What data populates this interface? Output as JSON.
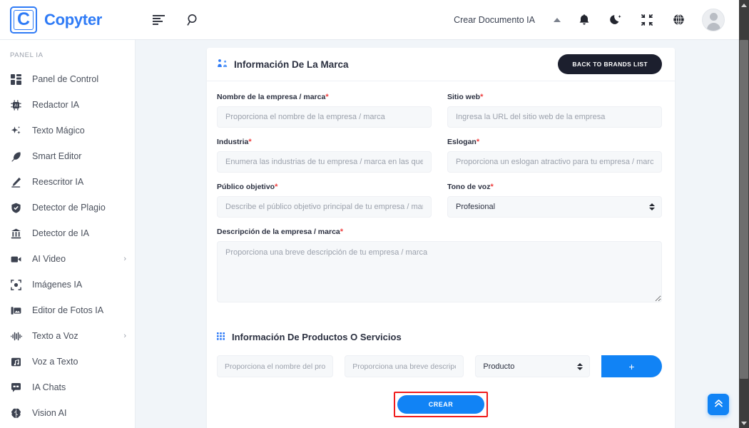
{
  "brand": {
    "logo_letter": "C",
    "name": "Copyter",
    "accent_color": "#2f7bf6"
  },
  "topbar": {
    "menu_icon": "list-menu-icon",
    "search_icon": "search-icon",
    "create_document_label": "Crear Documento IA",
    "caret_icon": "chevron-up-icon",
    "bell_icon": "bell-icon",
    "moon_icon": "moon-icon",
    "fullscreen_icon": "compress-icon",
    "globe_icon": "globe-icon",
    "avatar_icon": "user-avatar"
  },
  "sidebar": {
    "heading": "PANEL IA",
    "items": [
      {
        "label": "Panel de Control",
        "icon": "dashboard-grid-icon",
        "chevron": ""
      },
      {
        "label": "Redactor IA",
        "icon": "ai-chip-icon",
        "chevron": ""
      },
      {
        "label": "Texto Mágico",
        "icon": "sparkles-icon",
        "chevron": ""
      },
      {
        "label": "Smart Editor",
        "icon": "feather-pen-icon",
        "chevron": ""
      },
      {
        "label": "Reescritor IA",
        "icon": "pencil-icon",
        "chevron": ""
      },
      {
        "label": "Detector de Plagio",
        "icon": "shield-check-icon",
        "chevron": ""
      },
      {
        "label": "Detector de IA",
        "icon": "bank-detector-icon",
        "chevron": ""
      },
      {
        "label": "AI Video",
        "icon": "video-camera-icon",
        "chevron": "›"
      },
      {
        "label": "Imágenes IA",
        "icon": "image-frame-icon",
        "chevron": ""
      },
      {
        "label": "Editor de Fotos IA",
        "icon": "photo-editor-icon",
        "chevron": ""
      },
      {
        "label": "Texto a Voz",
        "icon": "audio-waveform-icon",
        "chevron": "›"
      },
      {
        "label": "Voz a Texto",
        "icon": "music-note-icon",
        "chevron": ""
      },
      {
        "label": "IA Chats",
        "icon": "chat-bubble-icon",
        "chevron": ""
      },
      {
        "label": "Vision AI",
        "icon": "brain-icon",
        "chevron": ""
      }
    ]
  },
  "card": {
    "title": "Información De La Marca",
    "title_icon": "brand-people-icon",
    "back_button": "BACK TO BRANDS LIST",
    "fields": {
      "company_name": {
        "label": "Nombre de la empresa / marca",
        "required": "*",
        "placeholder": "Proporciona el nombre de la empresa / marca",
        "value": ""
      },
      "website": {
        "label": "Sitio web",
        "required": "*",
        "placeholder": "Ingresa la URL del sitio web de la empresa",
        "value": ""
      },
      "industry": {
        "label": "Industria",
        "required": "*",
        "placeholder": "Enumera las industrias de tu empresa / marca en las que te enfoca",
        "value": ""
      },
      "slogan": {
        "label": "Eslogan",
        "required": "*",
        "placeholder": "Proporciona un eslogan atractivo para tu empresa / marca",
        "value": ""
      },
      "target_audience": {
        "label": "Público objetivo",
        "required": "*",
        "placeholder": "Describe el público objetivo principal de tu empresa / marca",
        "value": ""
      },
      "tone_of_voice": {
        "label": "Tono de voz",
        "required": "*",
        "selected": "Profesional",
        "options": [
          "Profesional"
        ]
      },
      "description": {
        "label": "Descripción de la empresa / marca",
        "required": "*",
        "placeholder": "Proporciona una breve descripción de tu empresa / marca",
        "value": ""
      }
    }
  },
  "products": {
    "title": "Información De Productos O Servicios",
    "title_icon": "grid-dots-icon",
    "name_placeholder": "Proporciona el nombre del producto",
    "desc_placeholder": "Proporciona una breve descripción",
    "type_selected": "Producto",
    "type_options": [
      "Producto"
    ],
    "add_button_label": "+"
  },
  "submit": {
    "label": "CREAR",
    "highlight_color": "#f01b1b",
    "button_color": "#1183f5"
  },
  "floating": {
    "scroll_top_icon": "double-chevron-up-icon"
  }
}
